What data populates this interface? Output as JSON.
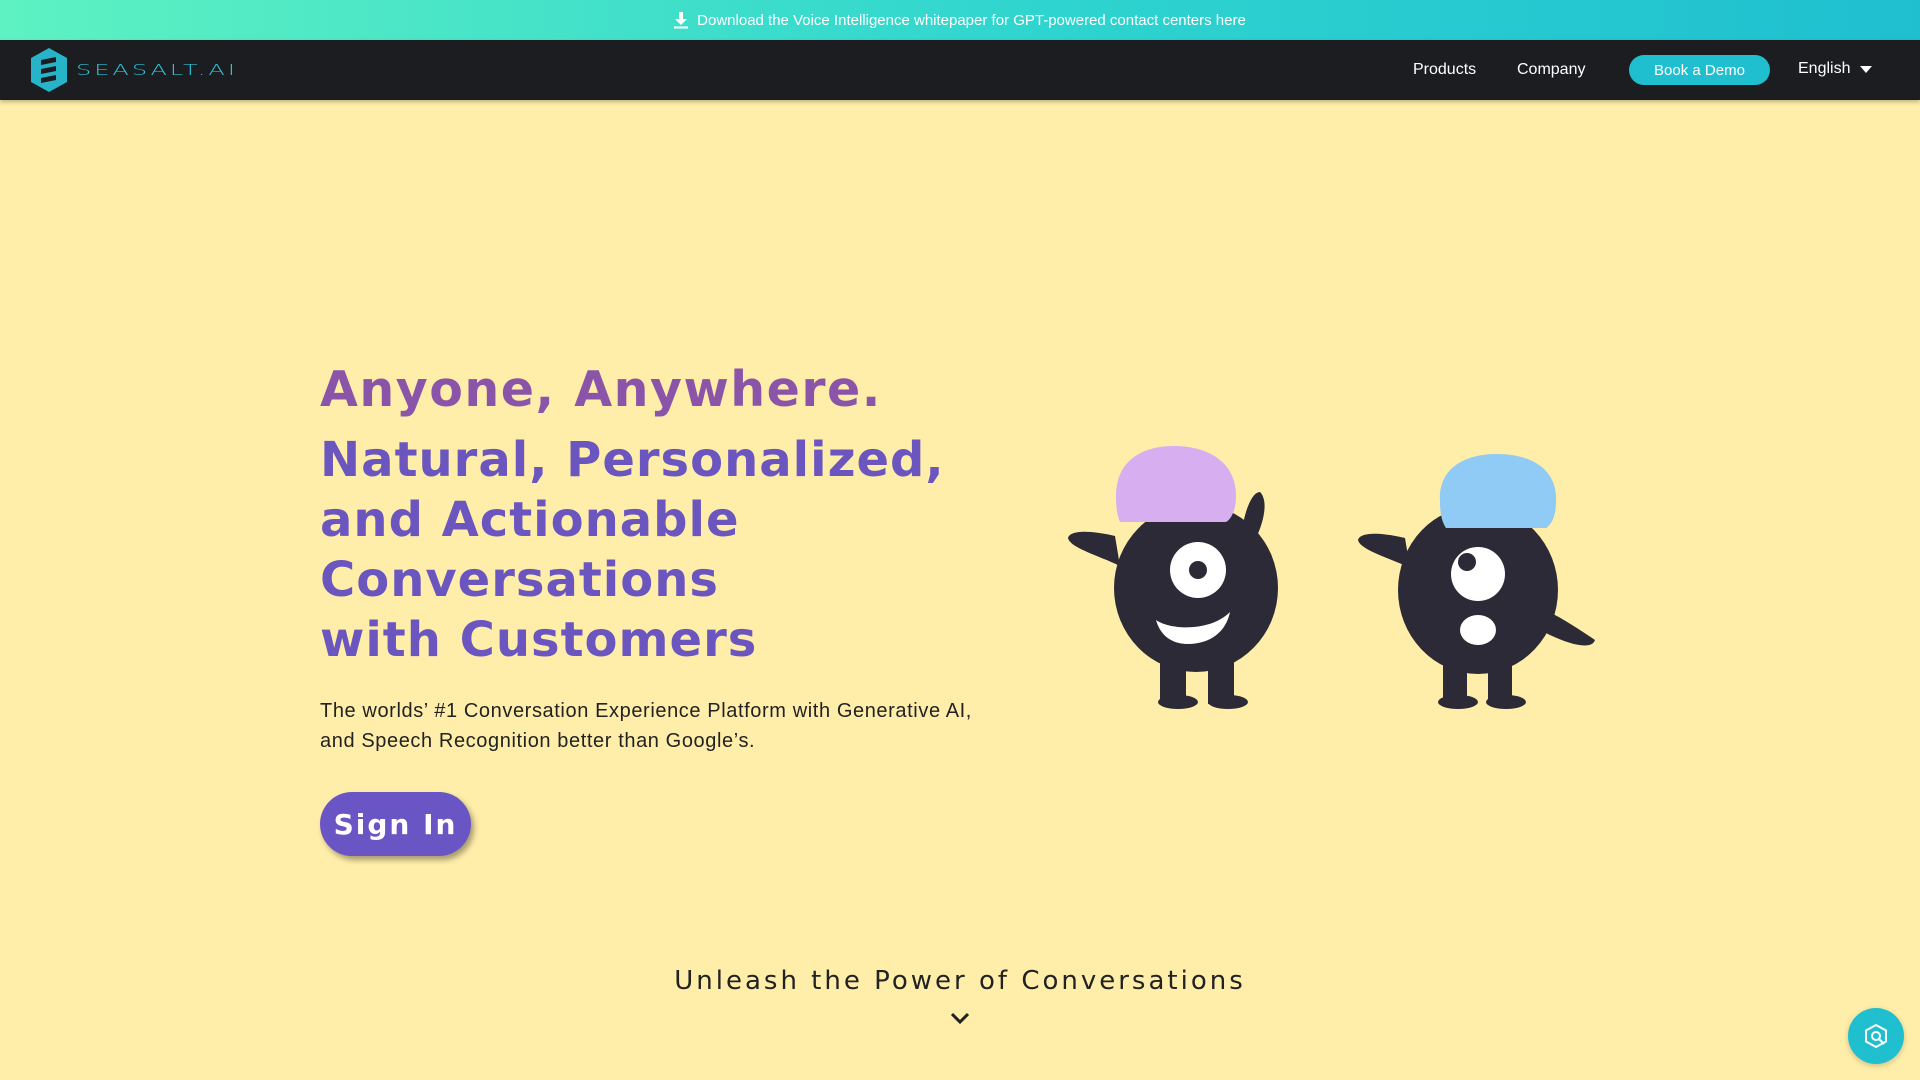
{
  "promo": {
    "text": "Download the Voice Intelligence whitepaper for GPT-powered contact centers here",
    "icon": "download-icon"
  },
  "nav": {
    "logo_text": "SEASALT.AI",
    "products": "Products",
    "company": "Company",
    "demo": "Book a Demo",
    "language": "English"
  },
  "hero": {
    "tagline": "Anyone, Anywhere.",
    "headline_lines": [
      "Natural, Personalized,",
      "and Actionable Conversations",
      "with Customers"
    ],
    "subtext_lines": [
      "The worlds’ #1 Conversation Experience Platform with Generative AI,",
      "and Speech Recognition better than Google’s."
    ],
    "signin": "Sign In"
  },
  "section": {
    "unleash": "Unleash the Power of Conversations"
  },
  "colors": {
    "background": "#ffeea9",
    "accent": "#1fbfcf",
    "purple": "#6a55c4",
    "mascot_body": "#2b2a36",
    "hat_left": "#d7aef0",
    "hat_right": "#8fcbf5"
  }
}
